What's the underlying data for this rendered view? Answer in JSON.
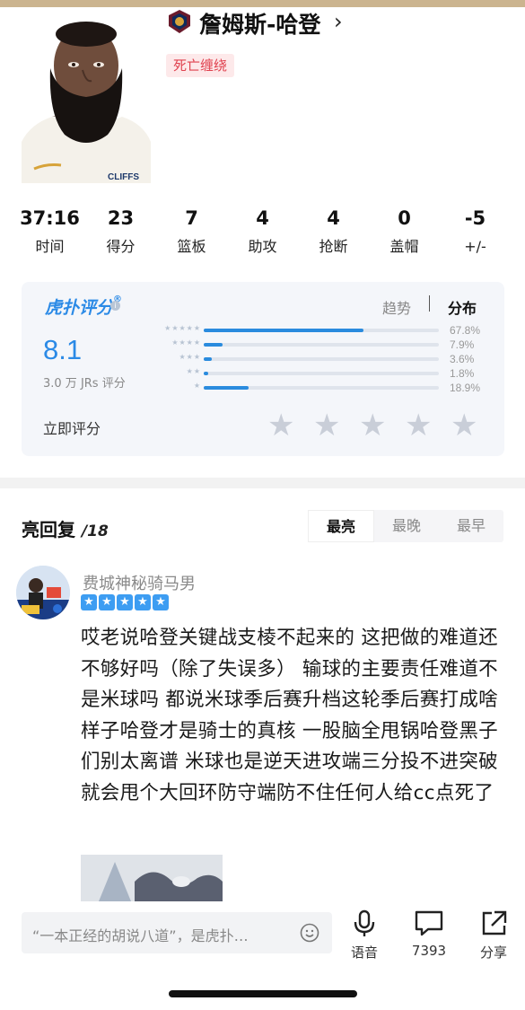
{
  "player": {
    "name": "詹姆斯-哈登",
    "chevron": "›",
    "tag": "死亡缠绕",
    "team_logo": "cavaliers-logo",
    "jersey_text": "CLIFFS"
  },
  "stats": [
    {
      "value": "37:16",
      "label": "时间"
    },
    {
      "value": "23",
      "label": "得分"
    },
    {
      "value": "7",
      "label": "篮板"
    },
    {
      "value": "4",
      "label": "助攻"
    },
    {
      "value": "4",
      "label": "抢断"
    },
    {
      "value": "0",
      "label": "盖帽"
    },
    {
      "value": "-5",
      "label": "+/-"
    }
  ],
  "rating": {
    "brand": "虎扑评分",
    "brand_mark": "®",
    "info_icon": "i",
    "tab_trend": "趋势",
    "tab_dist": "分布",
    "score": "8.1",
    "count_text": "3.0 万 JRs 评分",
    "distribution": [
      {
        "stars": "★★★★★",
        "fraction": 0.678,
        "pct": "67.8%"
      },
      {
        "stars": "★★★★",
        "fraction": 0.079,
        "pct": "7.9%"
      },
      {
        "stars": "★★★",
        "fraction": 0.036,
        "pct": "3.6%"
      },
      {
        "stars": "★★",
        "fraction": 0.018,
        "pct": "1.8%"
      },
      {
        "stars": "★",
        "fraction": 0.189,
        "pct": "18.9%"
      }
    ],
    "rate_now": "立即评分",
    "star_glyph": "★"
  },
  "comments": {
    "title": "亮回复",
    "count": "/18",
    "sort": [
      "最亮",
      "最晚",
      "最早"
    ],
    "active_sort": 0,
    "items": [
      {
        "user": "费城神秘骑马男",
        "stars": 5,
        "star_glyph": "★",
        "text": "哎老说哈登关键战支棱不起来的 这把做的难道还不够好吗（除了失误多） 输球的主要责任难道不是米球吗 都说米球季后赛升档这轮季后赛打成啥样子哈登才是骑士的真核 一股脑全甩锅哈登黑子们别太离谱 米球也是逆天进攻端三分投不进突破就会甩个大回环防守端防不住任何人给cc点死了"
      }
    ]
  },
  "bottom": {
    "placeholder": "“一本正经的胡说八道”，是虎扑…",
    "voice_label": "语音",
    "comment_count": "7393",
    "share_label": "分享"
  },
  "colors": {
    "accent": "#2b8ae6",
    "tag_red": "#e0424f",
    "bar_fill": "#2a8bde"
  }
}
